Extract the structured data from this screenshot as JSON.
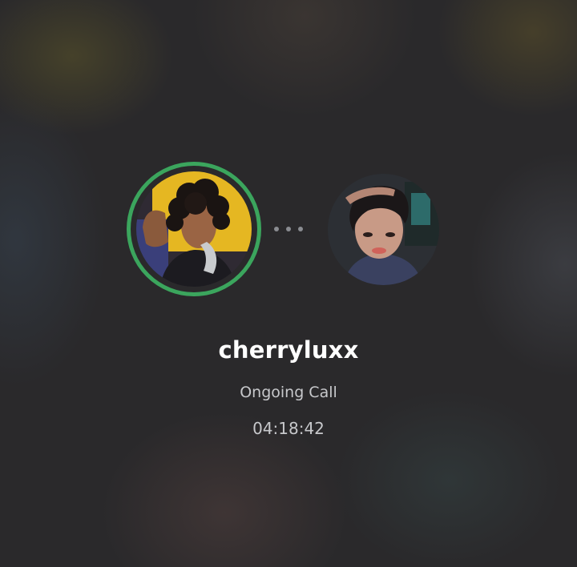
{
  "call": {
    "caller_name": "cherryluxx",
    "status": "Ongoing Call",
    "duration": "04:18:42"
  },
  "participants": [
    {
      "role": "speaking",
      "avatar": "avatar-photo-curly-hair",
      "speaking": true
    },
    {
      "role": "remote",
      "avatar": "avatar-photo-dark-hair",
      "speaking": false
    }
  ],
  "colors": {
    "speaking_ring": "#3ba55d",
    "background": "#2a292b",
    "status_text": "#c7c8cb",
    "name_text": "#ffffff",
    "dots": "#8a8c91"
  }
}
